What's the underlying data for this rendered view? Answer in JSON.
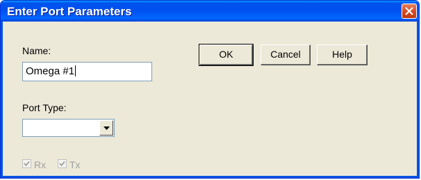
{
  "window": {
    "title": "Enter Port Parameters"
  },
  "form": {
    "name_label": "Name:",
    "name_value": "Omega #1",
    "port_type_label": "Port Type:",
    "port_type_value": ""
  },
  "buttons": {
    "ok": "OK",
    "cancel": "Cancel",
    "help": "Help"
  },
  "checkboxes": [
    {
      "label": "Rx",
      "checked": true,
      "enabled": false
    },
    {
      "label": "Tx",
      "checked": true,
      "enabled": false
    }
  ],
  "colors": {
    "titlebar": "#0054e3",
    "dialog_bg": "#ece9d8",
    "close_button": "#d8471d"
  }
}
